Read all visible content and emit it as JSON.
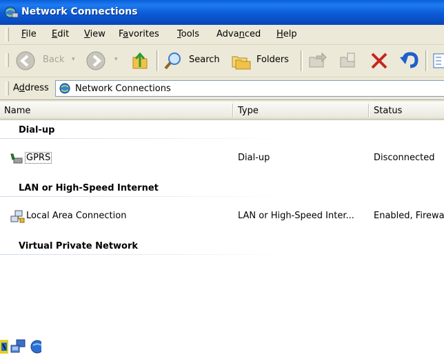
{
  "window": {
    "title": "Network Connections",
    "title_icon": "network-connections-icon"
  },
  "menu": {
    "items": [
      "File",
      "Edit",
      "View",
      "Favorites",
      "Tools",
      "Advanced",
      "Help"
    ],
    "mnemonics": [
      "F",
      "E",
      "V",
      "a",
      "T",
      "n",
      "H"
    ]
  },
  "toolbar": {
    "back_label": "Back",
    "search_label": "Search",
    "folders_label": "Folders"
  },
  "address": {
    "label": "Address",
    "label_mnemonic": "d",
    "value": "Network Connections"
  },
  "list": {
    "columns": [
      "Name",
      "Type",
      "Status"
    ],
    "groups": [
      {
        "label": "Dial-up",
        "rows": [
          {
            "name": "GPRS",
            "type": "Dial-up",
            "status": "Disconnected",
            "icon": "modem-phone-icon"
          }
        ]
      },
      {
        "label": "LAN or High-Speed Internet",
        "rows": [
          {
            "name": "Local Area Connection",
            "type": "LAN or High-Speed Inter...",
            "status": "Enabled, Firewa",
            "icon": "lan-connection-icon"
          }
        ]
      },
      {
        "label": "Virtual Private Network",
        "rows": []
      }
    ]
  },
  "tray": {
    "icons": [
      "security-shield-icon",
      "network-computers-icon",
      "internet-globe-icon"
    ]
  },
  "colors": {
    "titlebar": "#0b5bd6",
    "chrome": "#ece9d8",
    "header_border": "#c7c5b2"
  }
}
